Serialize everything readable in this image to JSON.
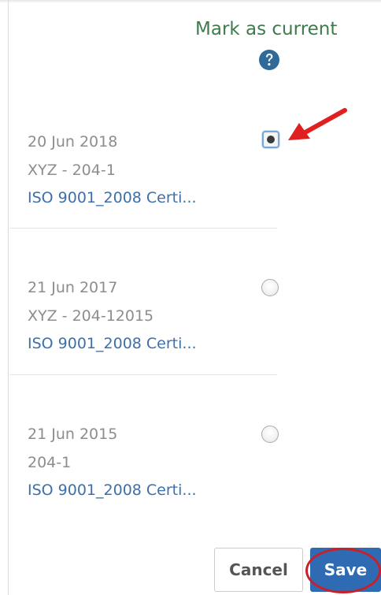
{
  "header": {
    "label": "Mark as current",
    "help_icon": "question-circle-icon"
  },
  "records": [
    {
      "date": "20 Jun 2018",
      "code": "XYZ - 204-1",
      "document": "ISO 9001_2008 Certi...",
      "selected": true
    },
    {
      "date": "21 Jun 2017",
      "code": "XYZ - 204-12015",
      "document": "ISO 9001_2008 Certi...",
      "selected": false
    },
    {
      "date": "21 Jun 2015",
      "code": "204-1",
      "document": "ISO 9001_2008 Certi...",
      "selected": false
    }
  ],
  "actions": {
    "cancel_label": "Cancel",
    "save_label": "Save"
  },
  "annotations": {
    "arrow_color": "#e02020",
    "highlight_color": "#c8202a"
  },
  "colors": {
    "header_text": "#3f7a4c",
    "link": "#3d6fa8",
    "primary_button": "#2f6bb3"
  }
}
